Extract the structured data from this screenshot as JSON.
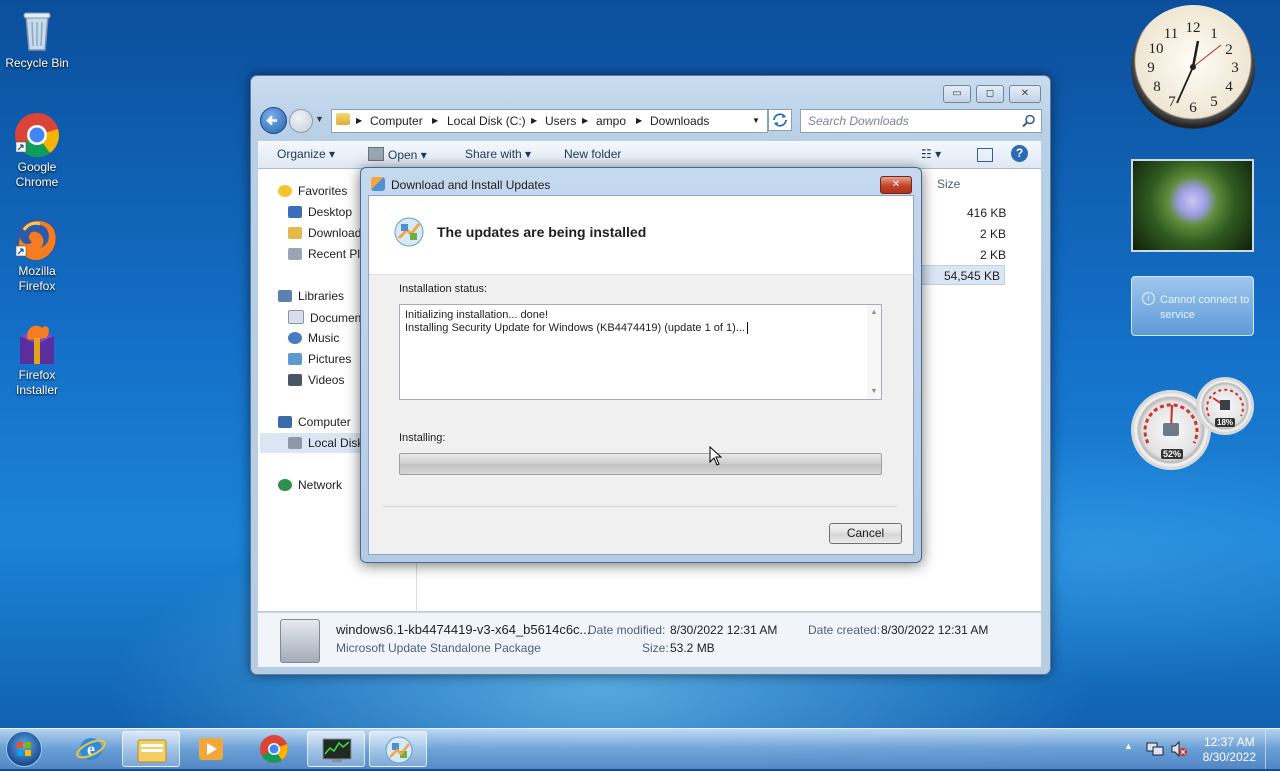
{
  "desktop": {
    "icons": [
      {
        "label": "Recycle Bin",
        "icon": "recycle-bin-icon"
      },
      {
        "label": "Google Chrome",
        "icon": "chrome-icon"
      },
      {
        "label": "Mozilla Firefox",
        "icon": "firefox-icon"
      },
      {
        "label": "Firefox Installer",
        "icon": "firefox-installer-icon"
      }
    ]
  },
  "explorer": {
    "window_controls": {
      "minimize": "▭",
      "maximize": "◻",
      "close": "✕"
    },
    "breadcrumb": [
      "Computer",
      "Local Disk (C:)",
      "Users",
      "ampo",
      "Downloads"
    ],
    "search_placeholder": "Search Downloads",
    "toolbar": {
      "organize": "Organize",
      "open": "Open",
      "share": "Share with",
      "new_folder": "New folder"
    },
    "nav": {
      "favorites": "Favorites",
      "desktop": "Desktop",
      "downloads": "Downloads",
      "recent": "Recent Places",
      "libraries": "Libraries",
      "documents": "Documents",
      "music": "Music",
      "pictures": "Pictures",
      "videos": "Videos",
      "computer": "Computer",
      "local_disk": "Local Disk (C:)",
      "network": "Network"
    },
    "column_size": "Size",
    "sizes": [
      "416 KB",
      "2 KB",
      "2 KB",
      "54,545 KB"
    ],
    "details": {
      "filename": "windows6.1-kb4474419-v3-x64_b5614c6c...",
      "type": "Microsoft Update Standalone Package",
      "modified_label": "Date modified:",
      "modified_value": "8/30/2022 12:31 AM",
      "size_label": "Size:",
      "size_value": "53.2 MB",
      "created_label": "Date created:",
      "created_value": "8/30/2022 12:31 AM"
    }
  },
  "dialog": {
    "title": "Download and Install Updates",
    "close": "✕",
    "heading": "The updates are being installed",
    "status_label": "Installation status:",
    "status_lines": [
      "Initializing installation... done!",
      "Installing Security Update for Windows (KB4474419) (update 1 of 1)..."
    ],
    "installing_label": "Installing:",
    "progress": 0,
    "cancel": "Cancel"
  },
  "gadgets": {
    "clock_numbers": [
      "12",
      "1",
      "2",
      "3",
      "4",
      "5",
      "6",
      "7",
      "8",
      "9",
      "10",
      "11"
    ],
    "weather_message": "Cannot connect to service",
    "cpu_percent": "52%",
    "memory_percent": "18%"
  },
  "taskbar": {
    "time": "12:37 AM",
    "date": "8/30/2022",
    "items": [
      "start-button",
      "ie-icon",
      "explorer-icon",
      "media-player-icon",
      "chrome-icon",
      "task-manager-icon",
      "windows-update-icon"
    ]
  }
}
